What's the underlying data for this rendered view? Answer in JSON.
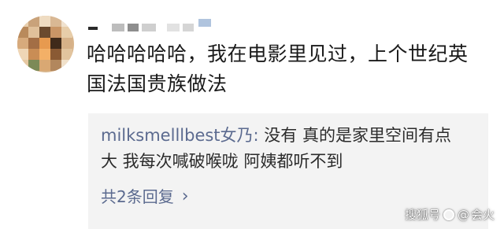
{
  "comment": {
    "text_line1": "哈哈哈哈哈，我在电影里见过，上个世纪英",
    "text_line2": "国法国贵族做法"
  },
  "reply": {
    "author": "milksmelllbest女乃: ",
    "text_part1": "没有 真的是家里空间有点",
    "text_part2": "大 我每次喊破喉咙 阿姨都听不到",
    "count_label": "共2条回复",
    "chevron": "›"
  },
  "watermark": {
    "site": "搜狐号",
    "at": "@",
    "name": "会火"
  },
  "colors": {
    "link_blue": "#5b6a8f",
    "reply_bg": "#f3f3f3",
    "text": "#1a1a1a"
  }
}
